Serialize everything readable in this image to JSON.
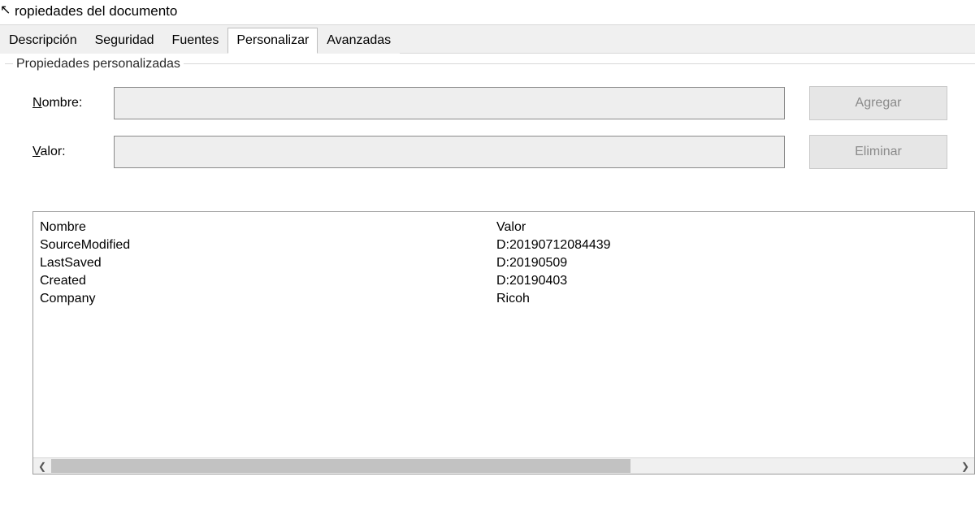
{
  "window": {
    "title": "ropiedades del documento"
  },
  "tabs": {
    "t0": "Descripción",
    "t1": "Seguridad",
    "t2": "Fuentes",
    "t3": "Personalizar",
    "t4": "Avanzadas"
  },
  "group": {
    "label": "Propiedades personalizadas"
  },
  "form": {
    "name_label_u": "N",
    "name_label_rest": "ombre:",
    "value_label_u": "V",
    "value_label_rest": "alor:",
    "name_value": "",
    "value_value": ""
  },
  "buttons": {
    "add": "Agregar",
    "delete": "Eliminar"
  },
  "table": {
    "headers": {
      "name": "Nombre",
      "value": "Valor"
    },
    "rows": [
      {
        "name": "SourceModified",
        "value": "D:20190712084439"
      },
      {
        "name": "LastSaved",
        "value": "D:20190509"
      },
      {
        "name": "Created",
        "value": "D:20190403"
      },
      {
        "name": "Company",
        "value": "Ricoh"
      }
    ]
  }
}
